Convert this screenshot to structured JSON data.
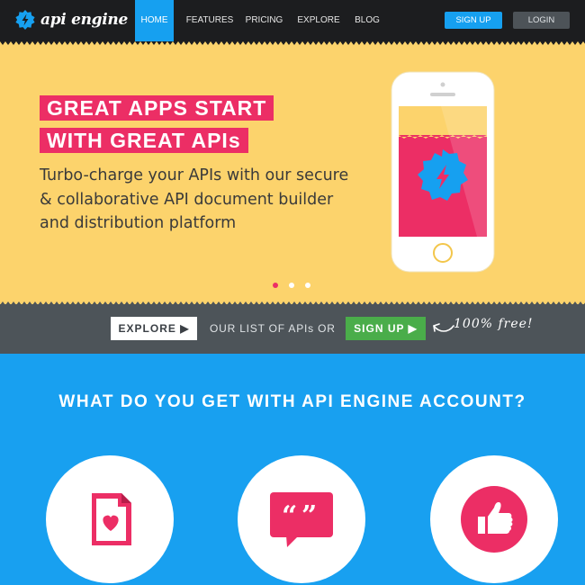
{
  "nav": {
    "brand": "api engine",
    "items": [
      {
        "label": "HOME",
        "active": true
      },
      {
        "label": "FEATURES",
        "active": false
      },
      {
        "label": "PRICING",
        "active": false
      },
      {
        "label": "EXPLORE",
        "active": false
      },
      {
        "label": "BLOG",
        "active": false
      }
    ],
    "signup_label": "SIGN UP",
    "login_label": "LOGIN"
  },
  "hero": {
    "headline_line1": "GREAT APPS START",
    "headline_line2": "WITH GREAT APIs",
    "subtitle": "Turbo-charge your APIs with our secure & collaborative API document builder and distribution platform",
    "slides_total": 3,
    "active_slide": 1
  },
  "cta": {
    "explore_label": "EXPLORE ▶",
    "middle_text": "OUR LIST OF APIs OR",
    "signup_label": "SIGN UP ▶",
    "note": "100% free!"
  },
  "features": {
    "title": "WHAT DO YOU GET WITH API ENGINE ACCOUNT?",
    "icons": [
      "document-heart-icon",
      "quote-bubble-icon",
      "thumbs-up-icon"
    ]
  },
  "colors": {
    "nav_bg": "#1c1d1f",
    "accent_blue": "#16a0f0",
    "hero_yellow": "#fcd36c",
    "accent_pink": "#ec2e65",
    "cta_gray": "#4d5459",
    "cta_green": "#4aad4a",
    "features_blue": "#18a0f0"
  }
}
